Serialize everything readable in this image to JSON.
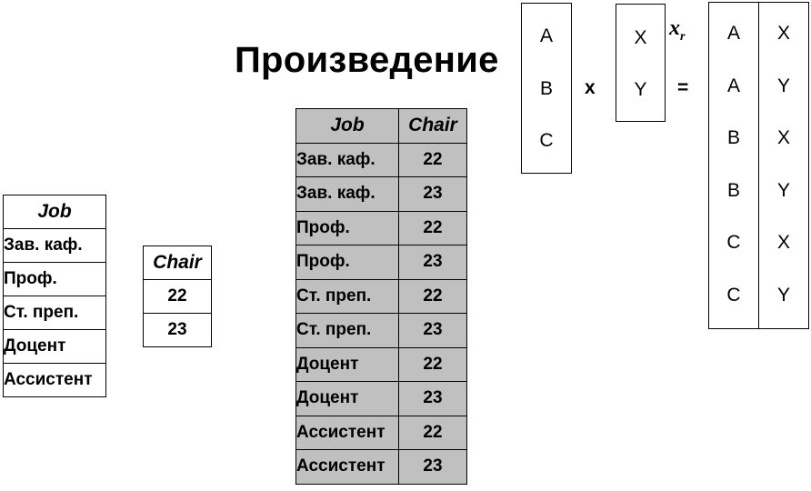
{
  "title": "Произведение",
  "job_table": {
    "header": "Job",
    "rows": [
      "Зав. каф.",
      "Проф.",
      "Ст. преп.",
      "Доцент",
      "Ассистент"
    ]
  },
  "chair_table": {
    "header": "Chair",
    "rows": [
      "22",
      "23"
    ]
  },
  "product_table": {
    "headers": [
      "Job",
      "Chair"
    ],
    "rows": [
      [
        "Зав. каф.",
        "22"
      ],
      [
        "Зав. каф.",
        "23"
      ],
      [
        "Проф.",
        "22"
      ],
      [
        "Проф.",
        "23"
      ],
      [
        "Ст. преп.",
        "22"
      ],
      [
        "Ст. преп.",
        "23"
      ],
      [
        "Доцент",
        "22"
      ],
      [
        "Доцент",
        "23"
      ],
      [
        "Ассистент",
        "22"
      ],
      [
        "Ассистент",
        "23"
      ]
    ]
  },
  "schema": {
    "left": [
      "A",
      "B",
      "C"
    ],
    "times_sign": "x",
    "right": [
      "X",
      "Y"
    ],
    "operator_label": "x",
    "operator_sub": "r",
    "equals_sign": "=",
    "result_col1": [
      "A",
      "A",
      "B",
      "B",
      "C",
      "C"
    ],
    "result_col2": [
      "X",
      "Y",
      "X",
      "Y",
      "X",
      "Y"
    ]
  },
  "colors": {
    "product_table_bg": "#c0c0c0"
  }
}
